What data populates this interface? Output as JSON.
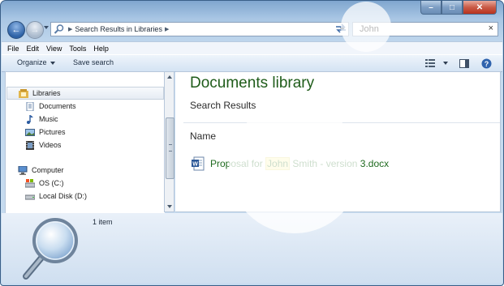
{
  "window": {
    "controls": {
      "minimize_icon": "minimize-icon",
      "maximize_icon": "maximize-icon",
      "close_icon": "close-icon"
    }
  },
  "address_bar": {
    "breadcrumb": "Search Results in Libraries",
    "icon": "magnifier-icon"
  },
  "search": {
    "value": "John",
    "clear_glyph": "×"
  },
  "menu": {
    "items": [
      "File",
      "Edit",
      "View",
      "Tools",
      "Help"
    ]
  },
  "commands": {
    "organize": "Organize",
    "save_search": "Save search"
  },
  "nav_pane": {
    "libraries": "Libraries",
    "library_items": [
      "Documents",
      "Music",
      "Pictures",
      "Videos"
    ],
    "computer": "Computer",
    "drives": [
      "OS (C:)",
      "Local Disk (D:)"
    ]
  },
  "content": {
    "title": "Documents library",
    "subtitle": "Search Results",
    "column_header": "Name",
    "result": {
      "before": "Proposal for ",
      "match": "John",
      "after": " Smith - version 3.docx"
    }
  },
  "details": {
    "item_count": "1 item"
  },
  "colors": {
    "title_green": "#1f5c1a",
    "result_green": "#1f6a1f",
    "highlight": "#fdf7a6",
    "frame_blue": "#a9c6e4"
  }
}
